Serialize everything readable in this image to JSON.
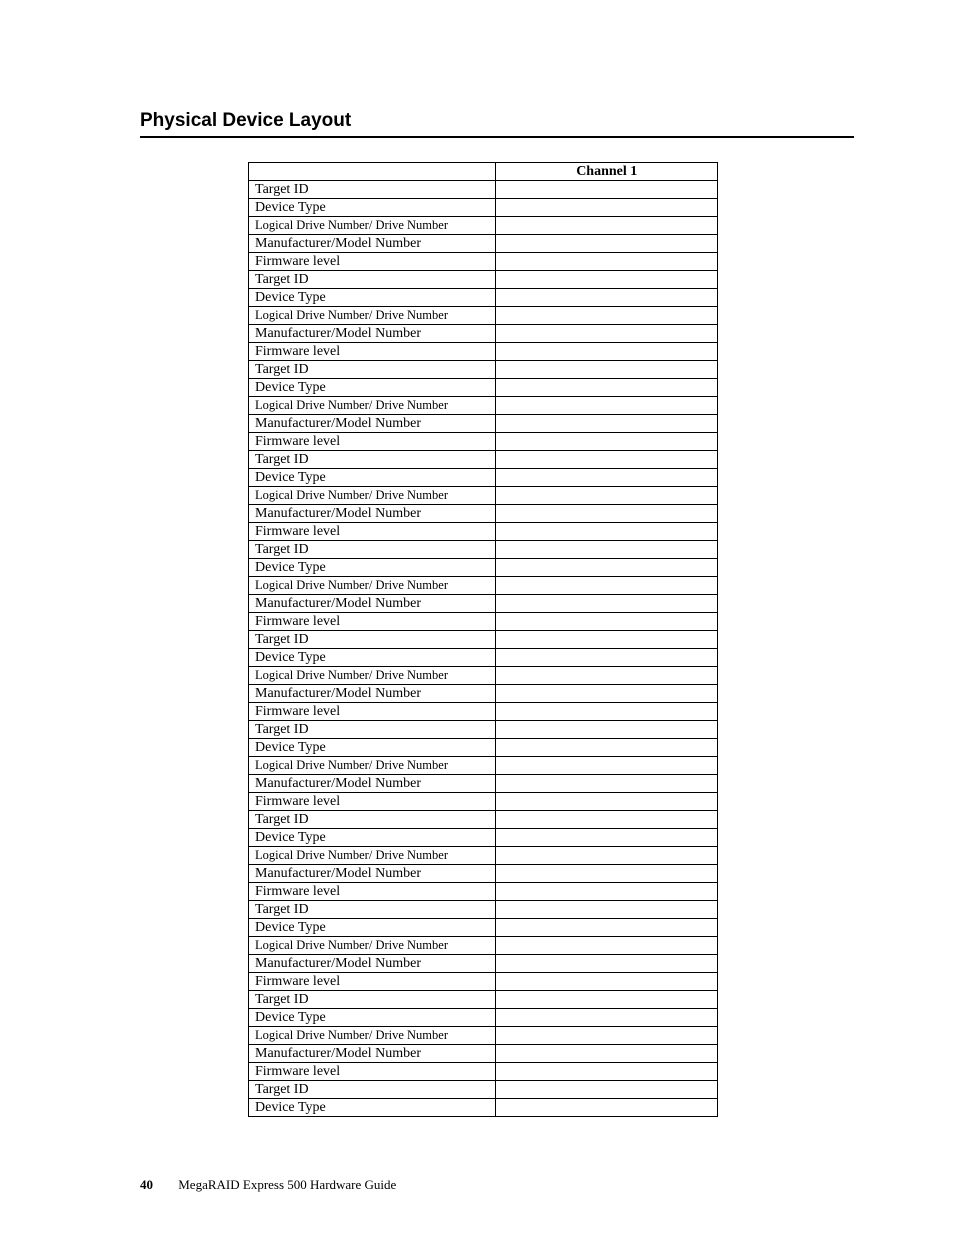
{
  "section_title": "Physical Device Layout",
  "table": {
    "header_col2": "Channel 1",
    "row_labels": [
      "Target ID",
      "Device Type",
      "Logical Drive Number/ Drive Number",
      "Manufacturer/Model Number",
      "Firmware level"
    ],
    "group_count": 10,
    "tail_rows": [
      "Target ID",
      "Device Type"
    ]
  },
  "footer": {
    "page_number": "40",
    "doc_title": "MegaRAID Express 500 Hardware Guide"
  }
}
